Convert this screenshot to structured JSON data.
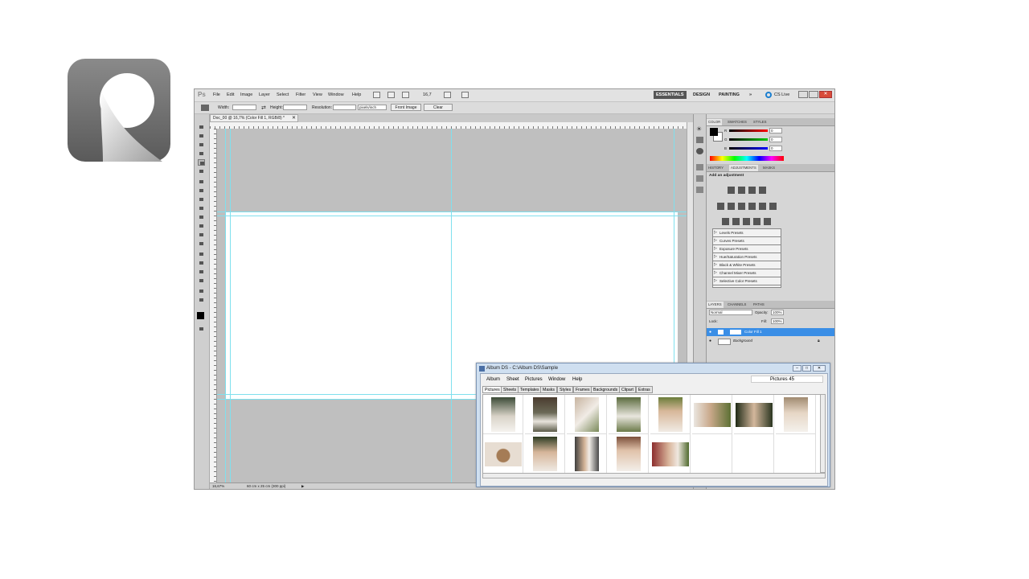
{
  "photoshop": {
    "logo": "Ps",
    "menus": [
      "File",
      "Edit",
      "Image",
      "Layer",
      "Select",
      "Filter",
      "View",
      "Window",
      "Help"
    ],
    "zoom": "16,7",
    "workspaces": [
      "ESSENTIALS",
      "DESIGN",
      "PAINTING"
    ],
    "more": "»",
    "cslive": "CS Live",
    "options": {
      "width_label": "Width:",
      "height_label": "Height:",
      "resolution_label": "Resolution:",
      "units": "pixels/inch",
      "front_image": "Front Image",
      "clear": "Clear"
    },
    "document_tab": "Doc_00 @ 16,7% (Color Fill 1, RGB/8) *",
    "status": {
      "zoom": "16,67%",
      "doc_size": "60 cm x 25 cm (300 ppi)"
    },
    "color_panel": {
      "tabs": [
        "COLOR",
        "SWATCHES",
        "STYLES"
      ],
      "channels": [
        {
          "label": "R",
          "value": "0",
          "color": "#d02020"
        },
        {
          "label": "G",
          "value": "0",
          "color": "#20a020"
        },
        {
          "label": "B",
          "value": "0",
          "color": "#2020d0"
        }
      ]
    },
    "adjustments_panel": {
      "tabs": [
        "HISTORY",
        "ADJUSTMENTS",
        "MASKS"
      ],
      "heading": "Add an adjustment",
      "presets": [
        "Levels Presets",
        "Curves Presets",
        "Exposure Presets",
        "Hue/Saturation Presets",
        "Black & White Presets",
        "Channel Mixer Presets",
        "Selective Color Presets"
      ]
    },
    "layers_panel": {
      "tabs": [
        "LAYERS",
        "CHANNELS",
        "PATHS"
      ],
      "blend_mode": "Normal",
      "opacity_label": "Opacity:",
      "opacity": "100%",
      "lock_label": "Lock:",
      "fill_label": "Fill:",
      "fill": "100%",
      "layers": [
        {
          "name": "Color Fill 1",
          "selected": true
        },
        {
          "name": "Background",
          "selected": false
        }
      ]
    }
  },
  "album_ds": {
    "title": "Album DS  -  C:\\Album DS\\Sample",
    "menus": [
      "Album",
      "Sheet",
      "Pictures",
      "Window",
      "Help"
    ],
    "pictures_count": "Pictures  45",
    "tabs": [
      "Pictures",
      "Sheets",
      "Templates",
      "Masks",
      "Styles",
      "Frames",
      "Backgrounds",
      "Clipart",
      "Extras"
    ],
    "active_tab": "Pictures"
  }
}
